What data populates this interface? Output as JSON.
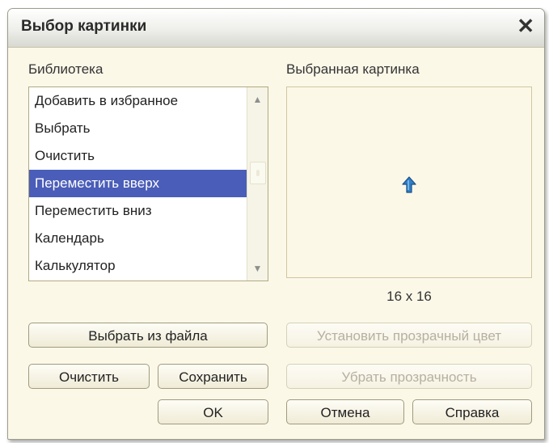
{
  "dialog": {
    "title": "Выбор картинки",
    "close_glyph": "✕"
  },
  "library": {
    "label": "Библиотека",
    "items": [
      {
        "label": "Добавить в избранное",
        "selected": false
      },
      {
        "label": "Выбрать",
        "selected": false
      },
      {
        "label": "Очистить",
        "selected": false
      },
      {
        "label": "Переместить вверх",
        "selected": true
      },
      {
        "label": "Переместить вниз",
        "selected": false
      },
      {
        "label": "Календарь",
        "selected": false
      },
      {
        "label": "Калькулятор",
        "selected": false
      }
    ],
    "scroll_up_glyph": "▲",
    "scroll_down_glyph": "▼"
  },
  "preview": {
    "label": "Выбранная картинка",
    "icon": "arrow-up-icon",
    "size_text": "16 x 16"
  },
  "buttons": {
    "choose_file": "Выбрать из файла",
    "clear": "Очистить",
    "save": "Сохранить",
    "set_transparent": "Установить прозрачный цвет",
    "remove_transparency": "Убрать прозрачность",
    "ok": "OK",
    "cancel": "Отмена",
    "help": "Справка"
  },
  "colors": {
    "selection": "#4a5db8",
    "dialog_bg": "#fbf8e8",
    "icon_blue": "#2f80c8"
  }
}
